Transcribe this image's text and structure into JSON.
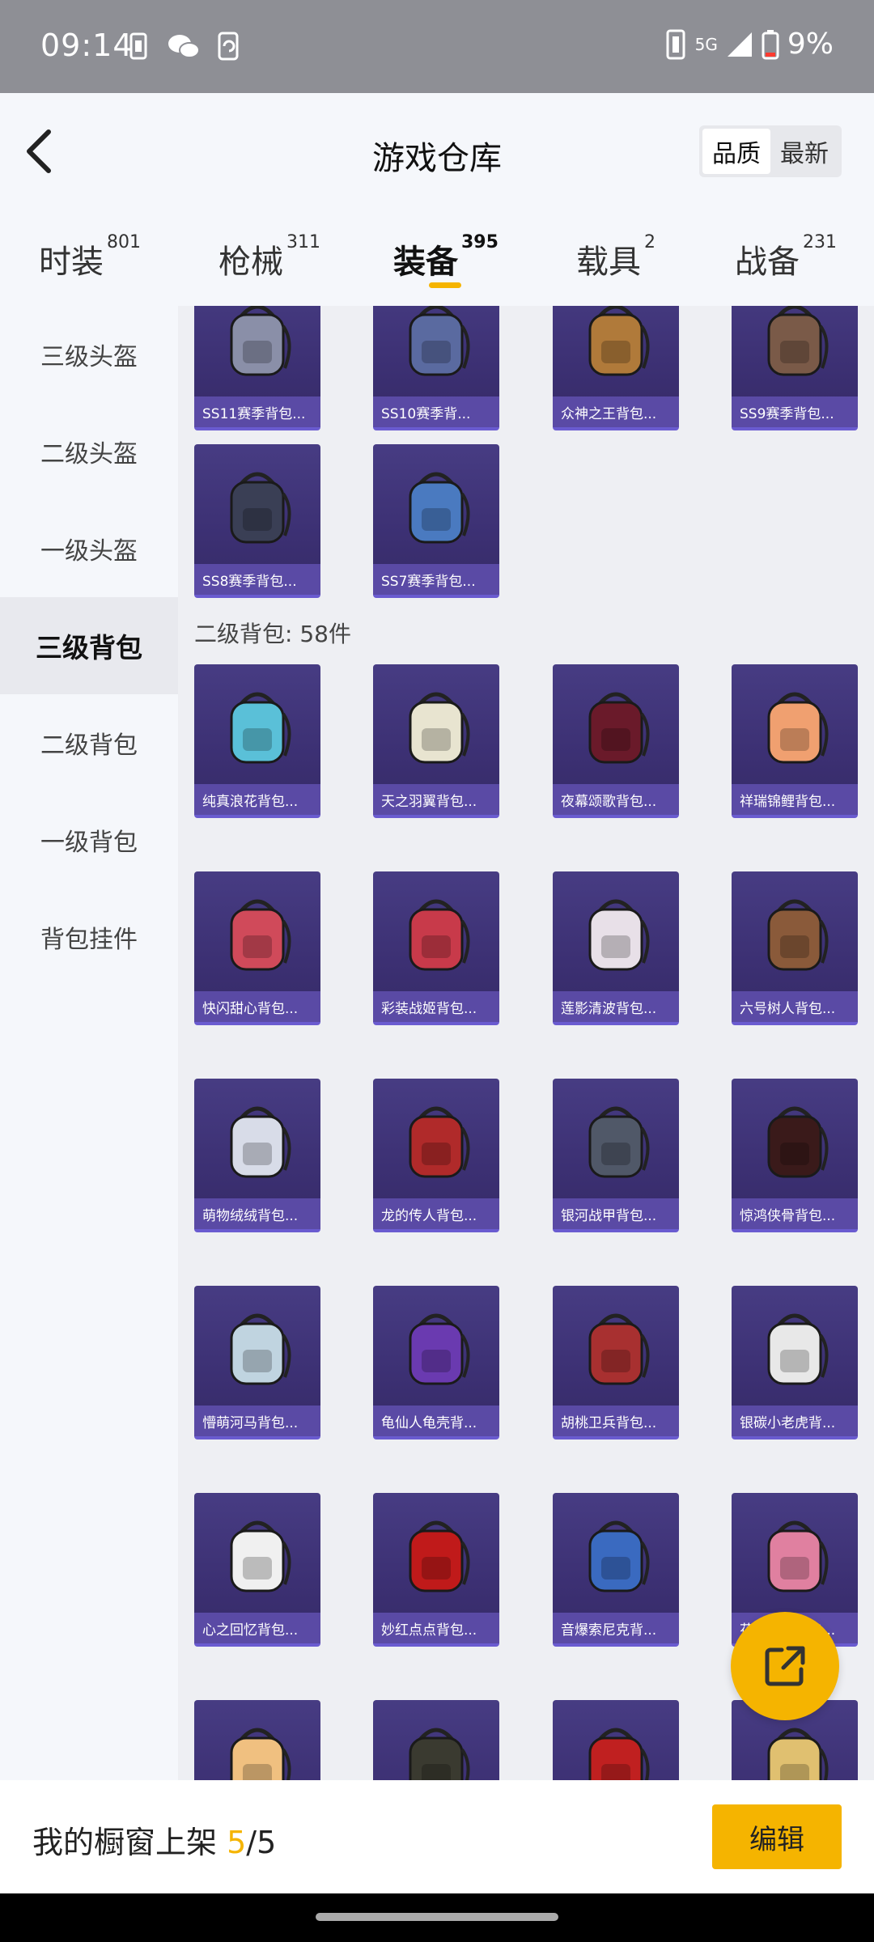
{
  "status_bar": {
    "time": "09:14",
    "network": "5G",
    "battery": "9%"
  },
  "header": {
    "title": "游戏仓库",
    "sort_options": [
      "品质",
      "最新"
    ],
    "selected_sort": "品质"
  },
  "tabs": [
    {
      "label": "时装",
      "count": "801"
    },
    {
      "label": "枪械",
      "count": "311"
    },
    {
      "label": "装备",
      "count": "395"
    },
    {
      "label": "载具",
      "count": "2"
    },
    {
      "label": "战备",
      "count": "231"
    }
  ],
  "active_tab": "装备",
  "sidebar": {
    "items": [
      "三级头盔",
      "二级头盔",
      "一级头盔",
      "三级背包",
      "二级背包",
      "一级背包",
      "背包挂件"
    ],
    "active": "三级背包"
  },
  "level3_backpacks": [
    "SS11赛季背包...",
    "SS10赛季背...",
    "众神之王背包...",
    "SS9赛季背包...",
    "SS8赛季背包...",
    "SS7赛季背包..."
  ],
  "level2_section": {
    "label": "二级背包: 58件",
    "items": [
      "纯真浪花背包...",
      "天之羽翼背包...",
      "夜幕颂歌背包...",
      "祥瑞锦鲤背包...",
      "快闪甜心背包...",
      "彩装战姬背包...",
      "莲影清波背包...",
      "六号树人背包...",
      "萌物绒绒背包...",
      "龙的传人背包...",
      "银河战甲背包...",
      "惊鸿侠骨背包...",
      "懵萌河马背包...",
      "龟仙人龟壳背...",
      "胡桃卫兵背包...",
      "银碳小老虎背...",
      "心之回忆背包...",
      "妙红点点背包...",
      "音爆索尼克背...",
      "花间之火背包...",
      "",
      "",
      "",
      ""
    ]
  },
  "bottom_bar": {
    "shelf_label": "我的橱窗上架",
    "shelf_count": "5",
    "shelf_total": "/5",
    "edit_label": "编辑"
  },
  "colors": {
    "accent": "#f5b400",
    "card_bg": "#3c3073",
    "card_label_bg": "#5a4aa5"
  }
}
